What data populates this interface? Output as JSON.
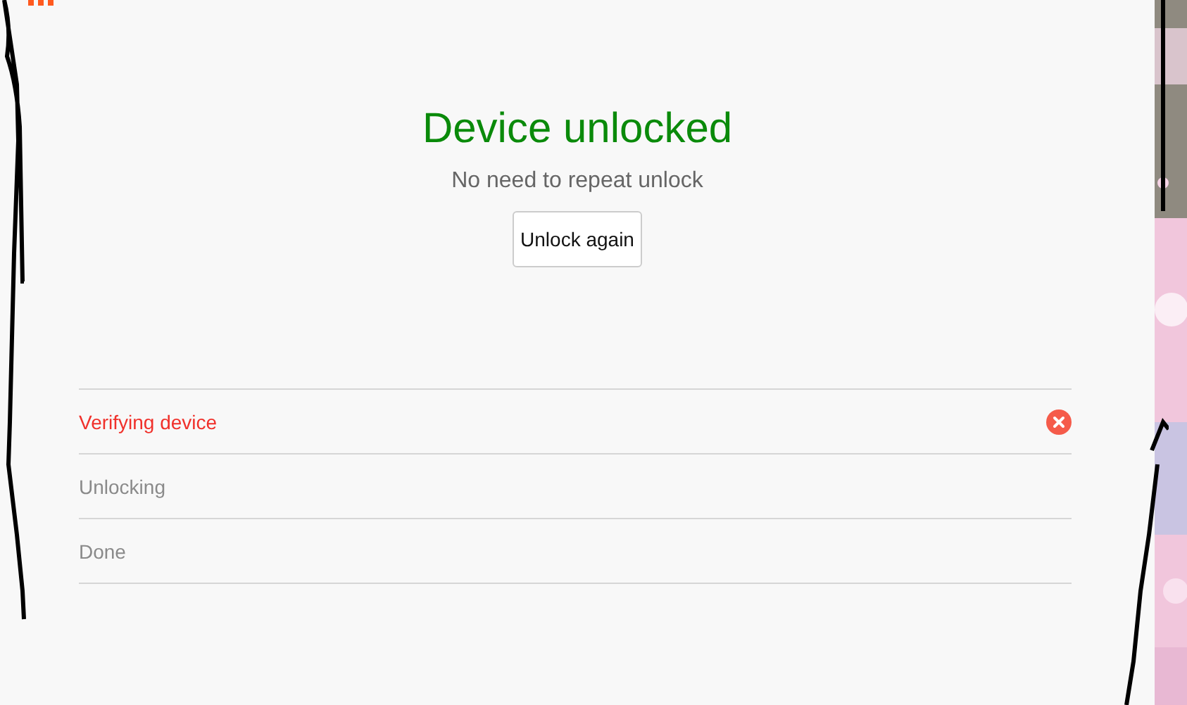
{
  "result": {
    "title": "Device unlocked",
    "subtitle": "No need to repeat unlock",
    "button": "Unlock again"
  },
  "steps": [
    {
      "label": "Verifying device",
      "kind": "error"
    },
    {
      "label": "Unlocking",
      "kind": "pending"
    },
    {
      "label": "Done",
      "kind": "pending"
    }
  ]
}
